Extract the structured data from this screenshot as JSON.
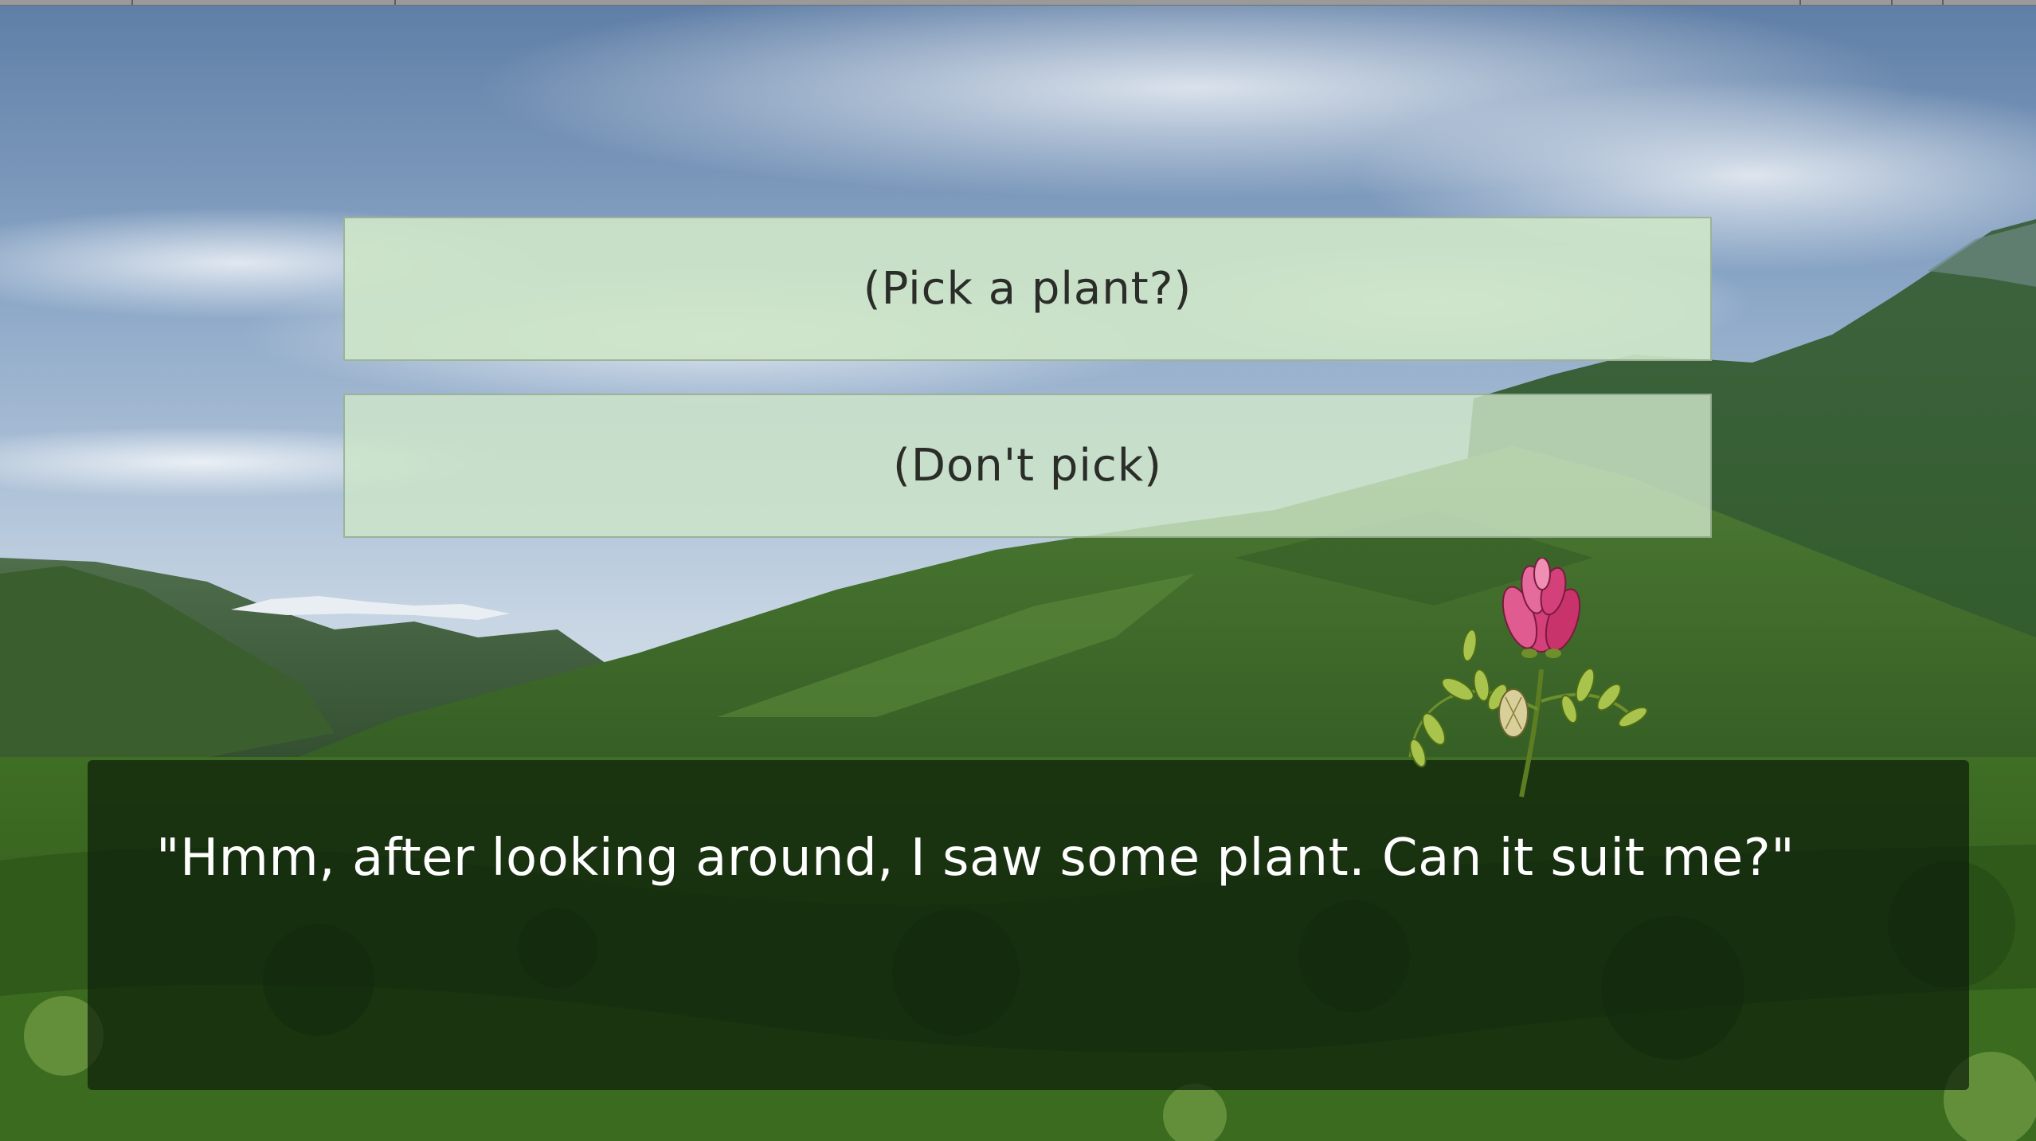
{
  "choices": [
    {
      "label": "(Pick a plant?)"
    },
    {
      "label": "(Don't pick)"
    }
  ],
  "dialogue": {
    "text": "\"Hmm, after looking around, I saw some plant. Can it suit me?\""
  },
  "colors": {
    "choice_bg": "#cde5c8",
    "choice_text": "#2b2d28",
    "dialogue_bg": "#0c1e0a",
    "dialogue_text": "#ffffff",
    "flower_petal": "#d4407a",
    "flower_stem": "#6f8f2a"
  },
  "icons": {
    "character": "pink-flower-sprite",
    "background": "mountain-valley-scene"
  }
}
